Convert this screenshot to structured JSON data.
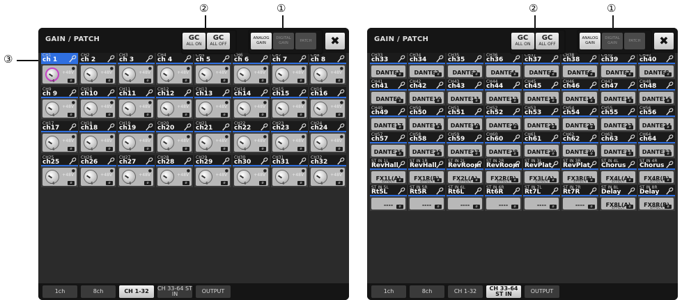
{
  "callouts": [
    "①",
    "②",
    "③"
  ],
  "left_screen": {
    "title": "GAIN / PATCH",
    "gc_buttons": [
      {
        "main": "GC",
        "sub": "ALL ON"
      },
      {
        "main": "GC",
        "sub": "ALL OFF"
      }
    ],
    "mode_buttons": [
      {
        "line1": "ANALOG",
        "line2": "GAIN",
        "active": true
      },
      {
        "line1": "DIGITAL",
        "line2": "GAIN",
        "active": false
      },
      {
        "line1": "PATCH",
        "line2": "",
        "active": false
      }
    ],
    "close_glyph": "✖",
    "cell_labels": {
      "phantom": "+48V",
      "gain": "−6",
      "phase": "ø"
    },
    "channels": [
      {
        "id": "CH1",
        "name": "ch 1"
      },
      {
        "id": "CH2",
        "name": "ch 2"
      },
      {
        "id": "CH3",
        "name": "ch 3"
      },
      {
        "id": "CH4",
        "name": "ch 4"
      },
      {
        "id": "CH5",
        "name": "ch 5"
      },
      {
        "id": "CH6",
        "name": "ch 6"
      },
      {
        "id": "CH7",
        "name": "ch 7"
      },
      {
        "id": "CH8",
        "name": "ch 8"
      },
      {
        "id": "CH9",
        "name": "ch 9"
      },
      {
        "id": "CH10",
        "name": "ch10"
      },
      {
        "id": "CH11",
        "name": "ch11"
      },
      {
        "id": "CH12",
        "name": "ch12"
      },
      {
        "id": "CH13",
        "name": "ch13"
      },
      {
        "id": "CH14",
        "name": "ch14"
      },
      {
        "id": "CH15",
        "name": "ch15"
      },
      {
        "id": "CH16",
        "name": "ch16"
      },
      {
        "id": "CH17",
        "name": "ch17"
      },
      {
        "id": "CH18",
        "name": "ch18"
      },
      {
        "id": "CH19",
        "name": "ch19"
      },
      {
        "id": "CH20",
        "name": "ch20"
      },
      {
        "id": "CH21",
        "name": "ch21"
      },
      {
        "id": "CH22",
        "name": "ch22"
      },
      {
        "id": "CH23",
        "name": "ch23"
      },
      {
        "id": "CH24",
        "name": "ch24"
      },
      {
        "id": "CH25",
        "name": "ch25"
      },
      {
        "id": "CH26",
        "name": "ch26"
      },
      {
        "id": "CH27",
        "name": "ch27"
      },
      {
        "id": "CH28",
        "name": "ch28"
      },
      {
        "id": "CH29",
        "name": "ch29"
      },
      {
        "id": "CH30",
        "name": "ch30"
      },
      {
        "id": "CH31",
        "name": "ch31"
      },
      {
        "id": "CH32",
        "name": "ch32"
      }
    ],
    "tabs": [
      "1ch",
      "8ch",
      "CH 1-32",
      "CH 33-64 ST IN",
      "OUTPUT"
    ],
    "active_tab": 2
  },
  "right_screen": {
    "title": "GAIN / PATCH",
    "gc_buttons": [
      {
        "main": "GC",
        "sub": "ALL ON"
      },
      {
        "main": "GC",
        "sub": "ALL OFF"
      }
    ],
    "mode_buttons": [
      {
        "line1": "ANALOG",
        "line2": "GAIN",
        "active": true
      },
      {
        "line1": "DIGITAL",
        "line2": "GAIN",
        "active": false
      },
      {
        "line1": "PATCH",
        "line2": "",
        "active": false
      }
    ],
    "close_glyph": "✖",
    "cells": [
      {
        "id": "CH33",
        "name": "ch33",
        "patch": "DANTE1"
      },
      {
        "id": "CH34",
        "name": "ch34",
        "patch": "DANTE2"
      },
      {
        "id": "CH35",
        "name": "ch35",
        "patch": "DANTE3"
      },
      {
        "id": "CH36",
        "name": "ch36",
        "patch": "DANTE4"
      },
      {
        "id": "CH37",
        "name": "ch37",
        "patch": "DANTE5"
      },
      {
        "id": "CH38",
        "name": "ch38",
        "patch": "DANTE6"
      },
      {
        "id": "CH39",
        "name": "ch39",
        "patch": "DANTE7"
      },
      {
        "id": "CH40",
        "name": "ch40",
        "patch": "DANTE8"
      },
      {
        "id": "CH41",
        "name": "ch41",
        "patch": "DANTE9"
      },
      {
        "id": "CH42",
        "name": "ch42",
        "patch": "DANTE10"
      },
      {
        "id": "CH43",
        "name": "ch43",
        "patch": "DANTE11"
      },
      {
        "id": "CH44",
        "name": "ch44",
        "patch": "DANTE12"
      },
      {
        "id": "CH45",
        "name": "ch45",
        "patch": "DANTE13"
      },
      {
        "id": "CH46",
        "name": "ch46",
        "patch": "DANTE14"
      },
      {
        "id": "CH47",
        "name": "ch47",
        "patch": "DANTE15"
      },
      {
        "id": "CH48",
        "name": "ch48",
        "patch": "DANTE16"
      },
      {
        "id": "CH49",
        "name": "ch49",
        "patch": "DANTE17"
      },
      {
        "id": "CH50",
        "name": "ch50",
        "patch": "DANTE18"
      },
      {
        "id": "CH51",
        "name": "ch51",
        "patch": "DANTE19"
      },
      {
        "id": "CH52",
        "name": "ch52",
        "patch": "DANTE20"
      },
      {
        "id": "CH53",
        "name": "ch53",
        "patch": "DANTE21"
      },
      {
        "id": "CH54",
        "name": "ch54",
        "patch": "DANTE22"
      },
      {
        "id": "CH55",
        "name": "ch55",
        "patch": "DANTE23"
      },
      {
        "id": "CH56",
        "name": "ch56",
        "patch": "DANTE24"
      },
      {
        "id": "CH57",
        "name": "ch57",
        "patch": "DANTE25"
      },
      {
        "id": "CH58",
        "name": "ch58",
        "patch": "DANTE26"
      },
      {
        "id": "CH59",
        "name": "ch59",
        "patch": "DANTE27"
      },
      {
        "id": "CH60",
        "name": "ch60",
        "patch": "DANTE28"
      },
      {
        "id": "CH61",
        "name": "ch61",
        "patch": "DANTE29"
      },
      {
        "id": "CH62",
        "name": "ch62",
        "patch": "DANTE30"
      },
      {
        "id": "CH63",
        "name": "ch63",
        "patch": "DANTE31"
      },
      {
        "id": "CH64",
        "name": "ch64",
        "patch": "DANTE32"
      },
      {
        "id": "ST IN 1L",
        "name": "RevHall",
        "patch": "FX1L(A)",
        "sub": "EFFECT"
      },
      {
        "id": "ST IN 1R",
        "name": "RevHall",
        "patch": "FX1R(B)",
        "sub": "EFFECT"
      },
      {
        "id": "ST IN 2L",
        "name": "RevRoom",
        "patch": "FX2L(A)",
        "sub": "EFFECT"
      },
      {
        "id": "ST IN 2R",
        "name": "RevRoom",
        "patch": "FX2R(B)",
        "sub": "EFFECT"
      },
      {
        "id": "ST IN 3L",
        "name": "RevPlat",
        "patch": "FX3L(A)",
        "sub": "EFFECT"
      },
      {
        "id": "ST IN 3R",
        "name": "RevPlat",
        "patch": "FX3R(B)",
        "sub": "EFFECT"
      },
      {
        "id": "ST IN 4L",
        "name": "Chorus",
        "patch": "FX4L(A)",
        "sub": "EFFECT"
      },
      {
        "id": "ST IN 4R",
        "name": "Chorus",
        "patch": "FX4R(B)",
        "sub": "EFFECT"
      },
      {
        "id": "ST IN 5L",
        "name": "Rt5L",
        "patch": "----"
      },
      {
        "id": "ST IN 5R",
        "name": "Rt5R",
        "patch": "----"
      },
      {
        "id": "ST IN 6L",
        "name": "Rt6L",
        "patch": "----"
      },
      {
        "id": "ST IN 6R",
        "name": "Rt6R",
        "patch": "----"
      },
      {
        "id": "ST IN 7L",
        "name": "Rt7L",
        "patch": "----"
      },
      {
        "id": "ST IN 7R",
        "name": "Rt7R",
        "patch": "----"
      },
      {
        "id": "ST IN 8L",
        "name": "Delay",
        "patch": "FX8L(A)",
        "sub": "EFFECT"
      },
      {
        "id": "ST IN 8R",
        "name": "Delay",
        "patch": "FX8R(B)",
        "sub": "EFFECT"
      }
    ],
    "phase": "ø",
    "tabs": [
      "1ch",
      "8ch",
      "CH 1-32",
      "CH 33-64 ST IN",
      "OUTPUT"
    ],
    "active_tab": 3
  }
}
